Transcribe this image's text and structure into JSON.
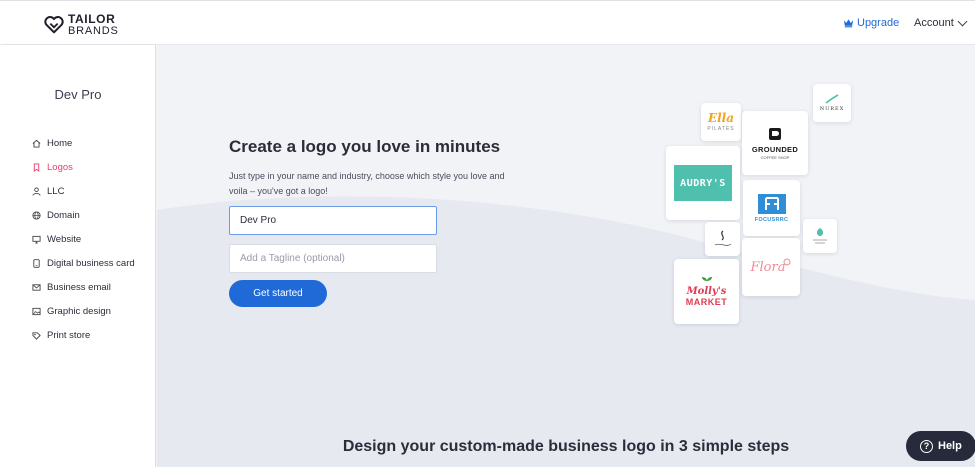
{
  "header": {
    "brand_line1": "TAILOR",
    "brand_line2": "BRANDS",
    "upgrade_label": "Upgrade",
    "account_label": "Account"
  },
  "sidebar": {
    "title": "Dev Pro",
    "items": [
      {
        "label": "Home",
        "icon": "home-icon"
      },
      {
        "label": "Logos",
        "icon": "bookmark-icon",
        "active": true
      },
      {
        "label": "LLC",
        "icon": "users-icon"
      },
      {
        "label": "Domain",
        "icon": "globe-icon"
      },
      {
        "label": "Website",
        "icon": "monitor-icon"
      },
      {
        "label": "Digital business card",
        "icon": "card-icon"
      },
      {
        "label": "Business email",
        "icon": "mail-icon"
      },
      {
        "label": "Graphic design",
        "icon": "image-icon"
      },
      {
        "label": "Print store",
        "icon": "tag-icon"
      }
    ]
  },
  "hero": {
    "title": "Create a logo you love in minutes",
    "subtitle": "Just type in your name and industry, choose which style you love and voila – you've got a logo!",
    "name_value": "Dev Pro",
    "tagline_placeholder": "Add a Tagline (optional)",
    "cta_label": "Get started"
  },
  "logos": {
    "ella": "Ella",
    "ella_sub": "PILATES",
    "grounded": "GROUNDED",
    "grounded_sub": "COFFEE SHOP",
    "nurex": "NUREX",
    "audrys": "AUDRY'S",
    "focus": "FOCUSRRC",
    "flora": "Flora",
    "mollys": "Molly's",
    "market": "MARKET"
  },
  "bottom": {
    "steps_title": "Design your custom-made business logo in 3 simple steps",
    "help_label": "Help"
  },
  "colors": {
    "accent": "#1f6ad6",
    "active_nav": "#e83e6c",
    "help_bg": "#262a3b",
    "teal": "#4fc0ad"
  }
}
